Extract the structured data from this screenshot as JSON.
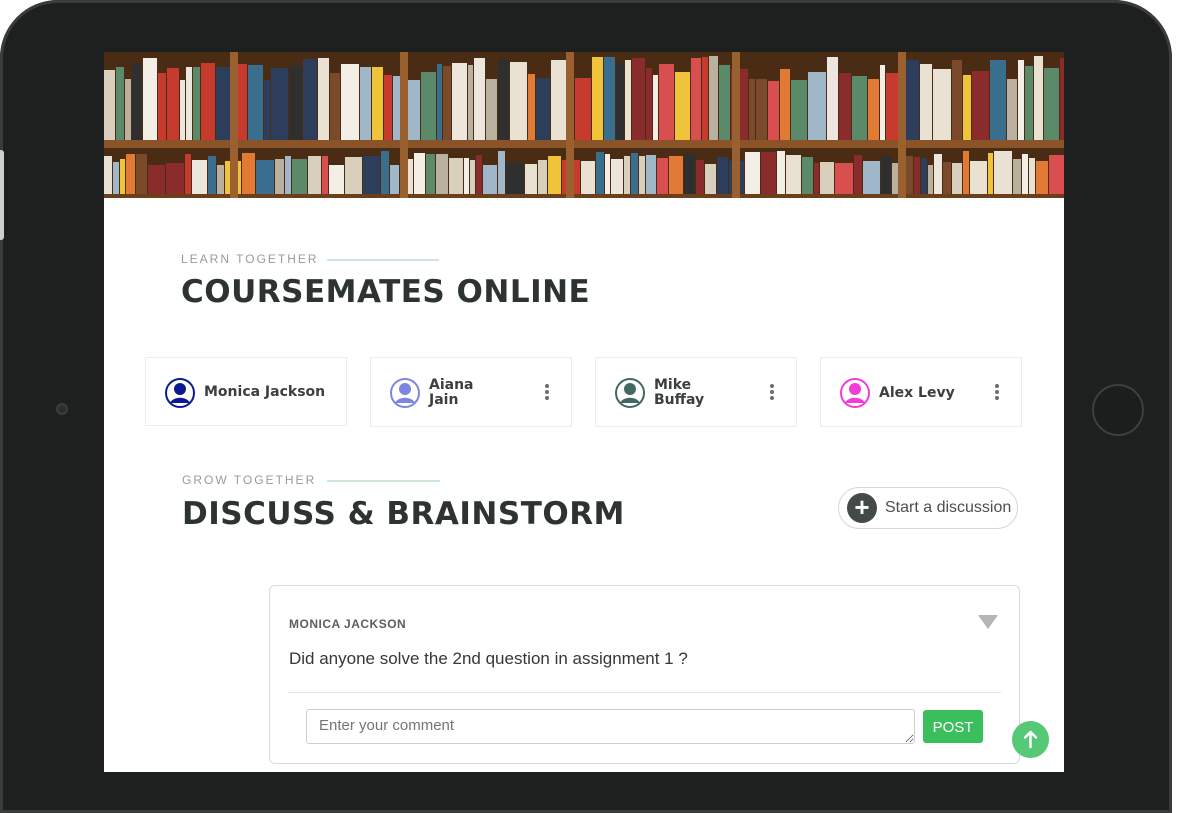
{
  "learn": {
    "eyebrow": "LEARN TOGETHER",
    "title": "COURSEMATES ONLINE"
  },
  "coursemates": [
    {
      "name": "Monica Jackson",
      "avatar_color": "#0b1a8f",
      "menu_icon": "kebab-icon"
    },
    {
      "name_line1": "Aiana",
      "name_line2": "Jain",
      "avatar_color": "#7b86e0",
      "menu_icon": "kebab-icon"
    },
    {
      "name_line1": "Mike",
      "name_line2": "Buffay",
      "avatar_color": "#436862",
      "menu_icon": "kebab-icon"
    },
    {
      "name": "Alex Levy",
      "avatar_color": "#f23bd9",
      "menu_icon": "kebab-icon"
    }
  ],
  "grow": {
    "eyebrow": "GROW TOGETHER",
    "title": "DISCUSS & BRAINSTORM"
  },
  "start_discussion": {
    "label": "Start a discussion",
    "icon": "plus-circle-icon"
  },
  "post": {
    "author": "MONICA JACKSON",
    "text": "Did anyone solve the 2nd question in assignment 1 ?",
    "comment_placeholder": "Enter your comment",
    "post_label": "POST",
    "toggle_icon": "triangle-down-icon"
  },
  "scroll_top": {
    "icon": "arrow-up-icon"
  },
  "colors": {
    "accent_green": "#3bbf5c",
    "title": "#2c3330",
    "frame": "#1e1f1f"
  }
}
